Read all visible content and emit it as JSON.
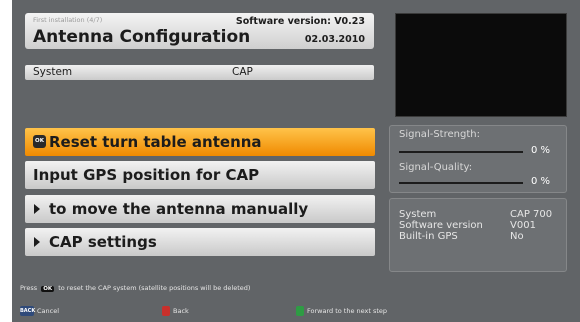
{
  "header": {
    "step": "First installation (4/7)",
    "title": "Antenna Configuration",
    "software_version": "Software version: V0.23",
    "date": "02.03.2010"
  },
  "system_row": {
    "key": "System",
    "value": "CAP"
  },
  "menu": {
    "selected_icon": "ok-button-icon",
    "items": [
      {
        "label": "Reset turn table antenna",
        "icon": "ok-icon",
        "selected": true
      },
      {
        "label": "Input GPS position for CAP",
        "icon": "",
        "selected": false
      },
      {
        "label": "to move the antenna manually",
        "icon": "arrow-right-icon",
        "selected": false
      },
      {
        "label": "CAP settings",
        "icon": "arrow-right-icon",
        "selected": false
      }
    ]
  },
  "signal": {
    "strength_label": "Signal-Strength:",
    "strength_value": "0 %",
    "strength_fraction": 0,
    "quality_label": "Signal-Quality:",
    "quality_value": "0 %",
    "quality_fraction": 0
  },
  "info": [
    {
      "key": "System",
      "value": "CAP 700"
    },
    {
      "key": "Software version",
      "value": "V001"
    },
    {
      "key": "Built-in GPS",
      "value": "No"
    }
  ],
  "hint": {
    "pre": "Press",
    "key": "OK",
    "post": "to reset the CAP system (satellite positions will be deleted)"
  },
  "footer": {
    "cancel_key": "BACK",
    "cancel": "Cancel",
    "back": "Back",
    "forward": "Forward to the next step"
  },
  "colors": {
    "background": "#616467",
    "selected_item": "#f7a21b",
    "back_key": "#c9302c",
    "forward_key": "#2e9c44"
  }
}
